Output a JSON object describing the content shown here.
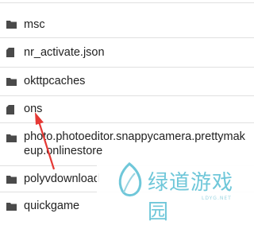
{
  "files": {
    "items": [
      {
        "name": "msc",
        "kind": "folder"
      },
      {
        "name": "nr_activate.json",
        "kind": "file"
      },
      {
        "name": "okttpcaches",
        "kind": "folder"
      },
      {
        "name": "ons",
        "kind": "file"
      },
      {
        "name": "photo.photoeditor.snappycamera.prettymakeup.onlinestore",
        "kind": "folder"
      },
      {
        "name": "polyvdownload",
        "kind": "folder"
      },
      {
        "name": "quickgame",
        "kind": "folder"
      }
    ]
  },
  "watermark": {
    "title": "绿道游戏园",
    "subtitle": "LDYG.NET"
  },
  "colors": {
    "icon": "#4a4a4a",
    "divider": "#e0e0e0",
    "arrow": "#e53935",
    "watermark": "#6fc7d9"
  }
}
